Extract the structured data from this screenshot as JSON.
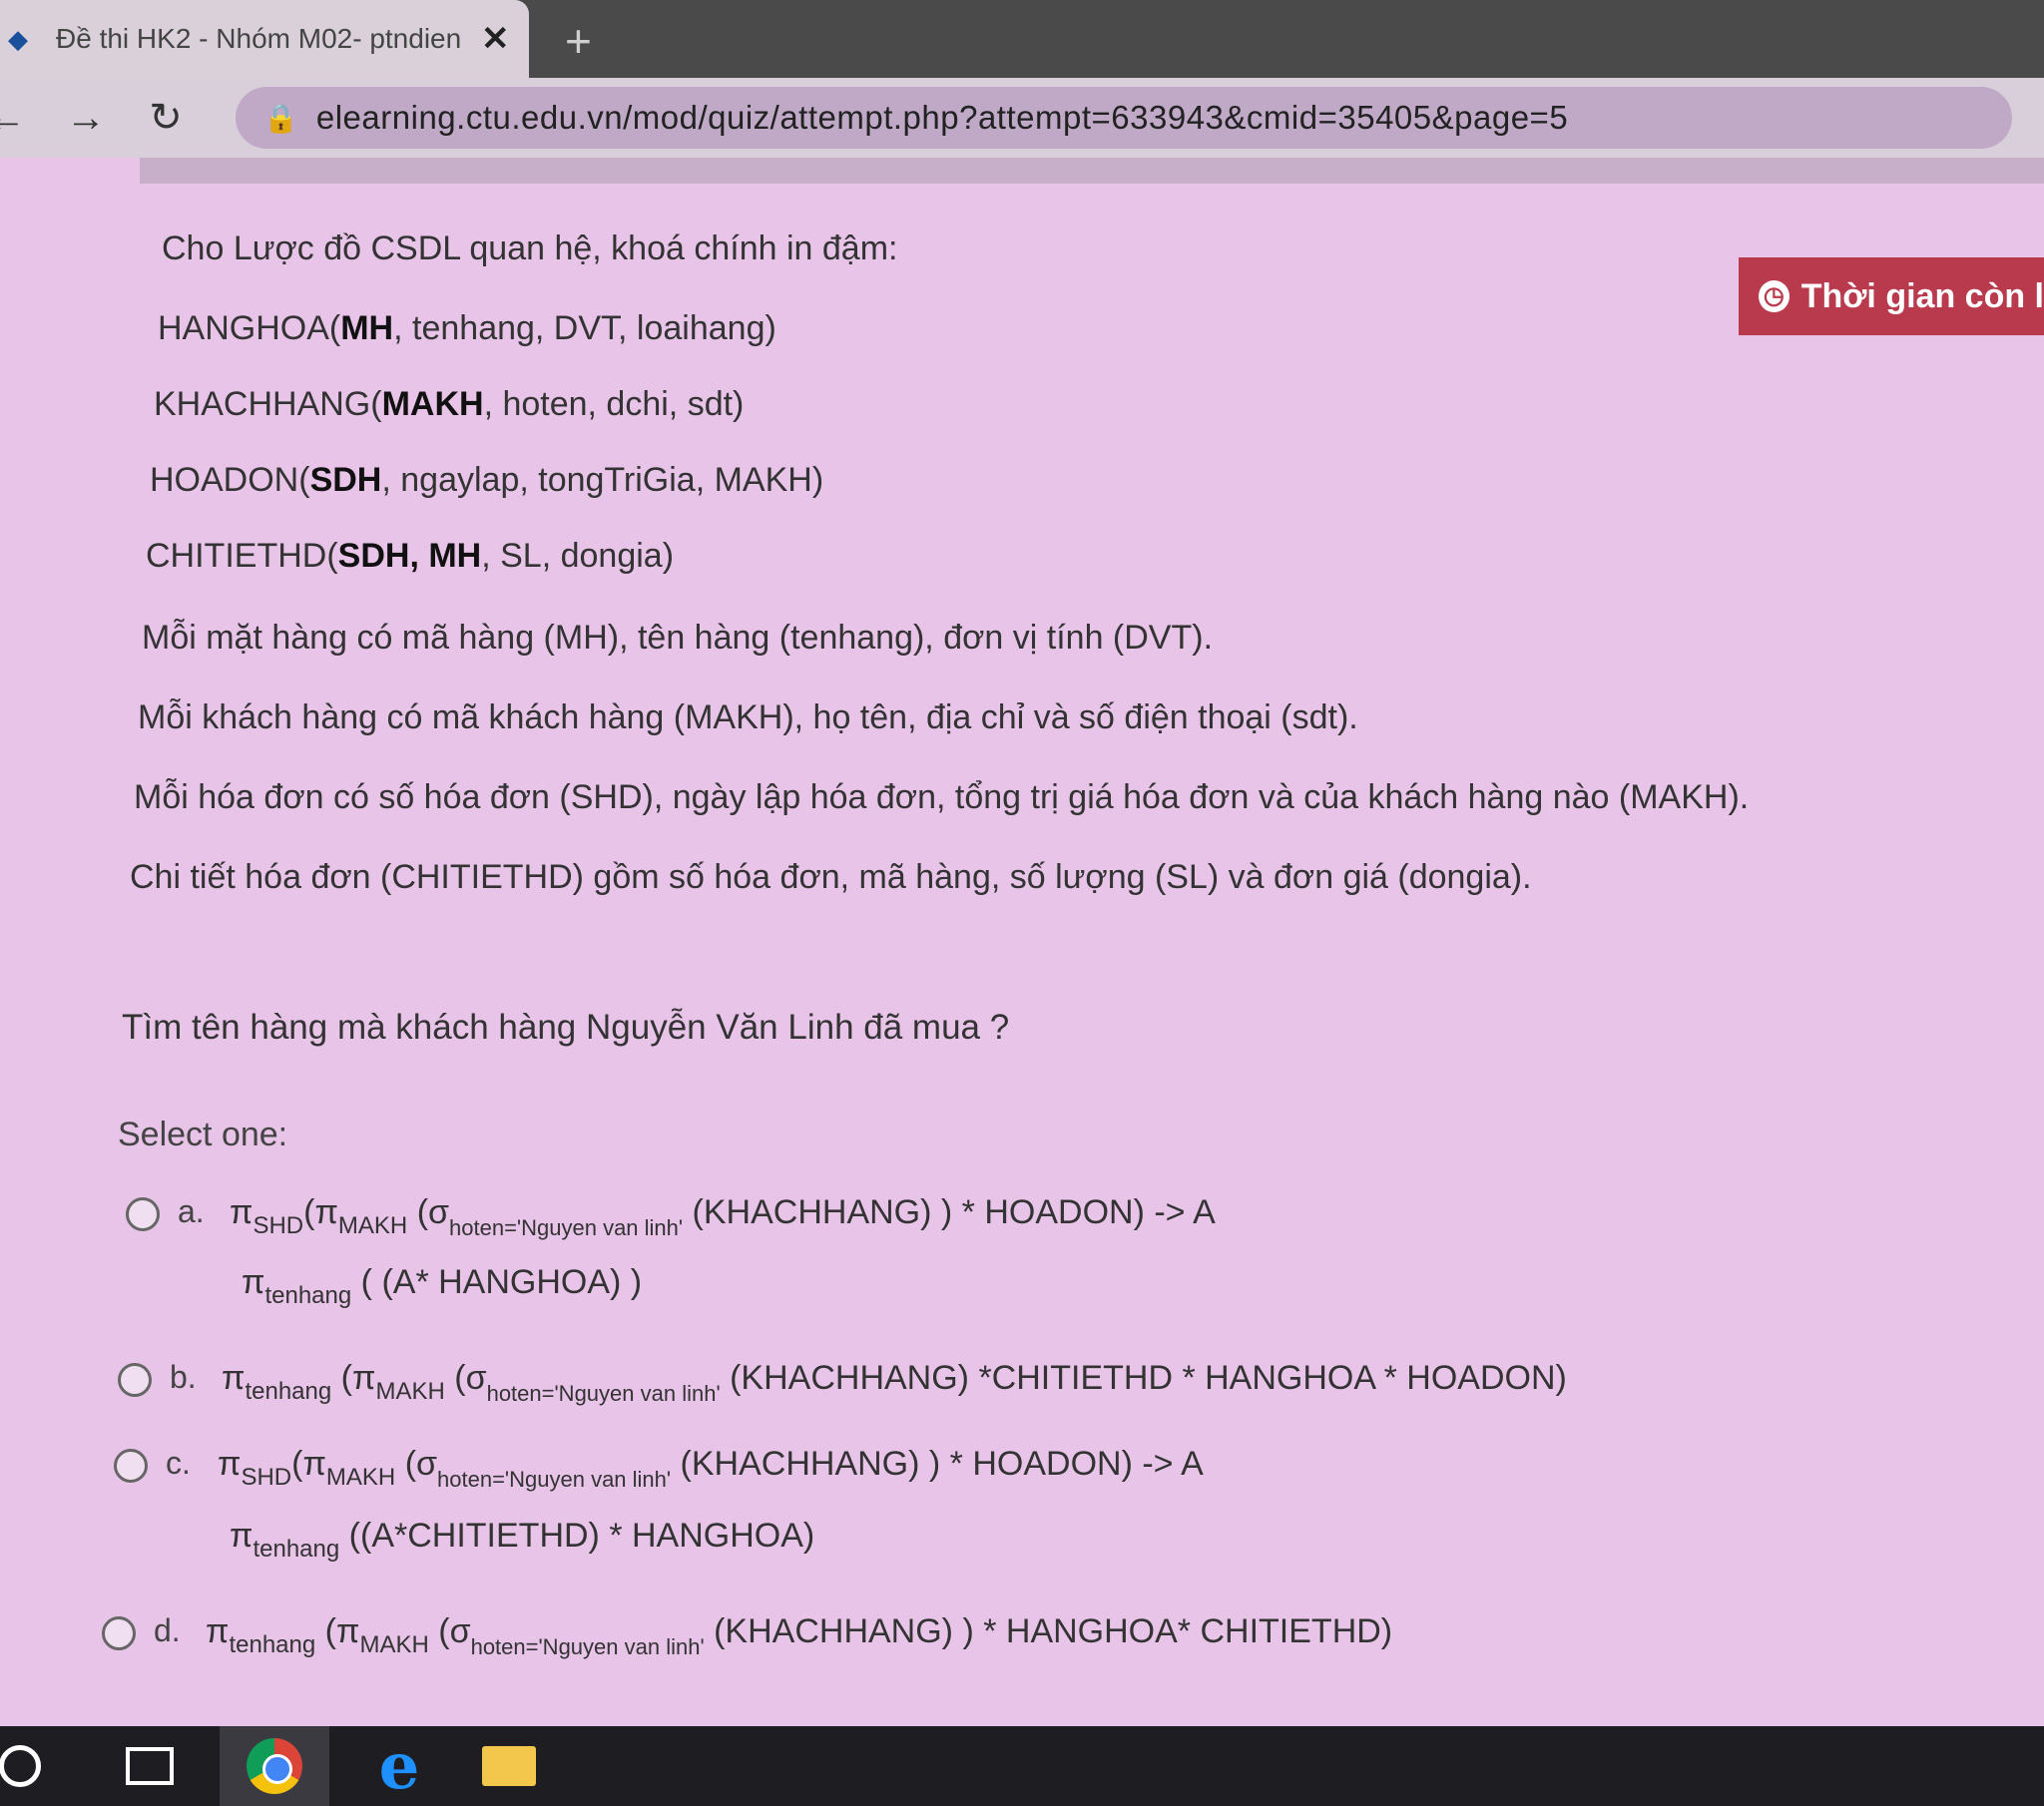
{
  "browser": {
    "tab_title": "Đề thi HK2 - Nhóm M02- ptndien",
    "tab_close": "✕",
    "new_tab": "+",
    "back": "←",
    "forward": "→",
    "reload": "↻",
    "url": "elearning.ctu.edu.vn/mod/quiz/attempt.php?attempt=633943&cmid=35405&page=5"
  },
  "timer": {
    "label": "Thời gian còn l"
  },
  "question": {
    "intro": "Cho Lược đồ CSDL quan hệ, khoá chính in đậm:",
    "schemas": [
      {
        "name": "HANGHOA(",
        "keys": "MH",
        "rest": ", tenhang, DVT, loaihang)"
      },
      {
        "name": "KHACHHANG(",
        "keys": "MAKH",
        "rest": ", hoten, dchi, sdt)"
      },
      {
        "name": "HOADON(",
        "keys": "SDH",
        "rest": ", ngaylap, tongTriGia, MAKH)"
      },
      {
        "name": "CHITIETHD(",
        "keys": "SDH, MH",
        "rest": ", SL, dongia)"
      }
    ],
    "descriptions": [
      "Mỗi mặt hàng có mã hàng (MH), tên hàng (tenhang), đơn vị tính (DVT).",
      "Mỗi khách hàng có mã khách hàng (MAKH), họ tên, địa chỉ và số điện thoại (sdt).",
      "Mỗi hóa đơn có số hóa đơn (SHD), ngày lập hóa đơn, tổng trị giá hóa đơn và của khách hàng nào (MAKH).",
      "Chi tiết hóa đơn (CHITIETHD) gồm số hóa đơn, mã hàng, số lượng (SL) và đơn giá (dongia)."
    ],
    "prompt": "Tìm tên hàng mà khách hàng Nguyễn Văn Linh đã mua ?",
    "select_one": "Select one:",
    "options": [
      {
        "letter": "a.",
        "line1": {
          "p1": "π",
          "s1": "SHD",
          "p2": "(π",
          "s2": "MAKH",
          "p3": " (σ",
          "s3": "hoten='Nguyen van linh'",
          "p4": " (KHACHHANG) ) * HOADON) -> A"
        },
        "line2": {
          "p1": "π",
          "s1": "tenhang",
          "p2": " ( (A* HANGHOA) )"
        }
      },
      {
        "letter": "b.",
        "line1": {
          "p1": "π",
          "s1": "tenhang",
          "p2": " (π",
          "s2": "MAKH",
          "p3": " (σ",
          "s3": "hoten='Nguyen van linh'",
          "p4": " (KHACHHANG) *CHITIETHD * HANGHOA * HOADON)"
        }
      },
      {
        "letter": "c.",
        "line1": {
          "p1": "π",
          "s1": "SHD",
          "p2": "(π",
          "s2": "MAKH",
          "p3": " (σ",
          "s3": "hoten='Nguyen van linh'",
          "p4": " (KHACHHANG) ) * HOADON) -> A"
        },
        "line2": {
          "p1": "π",
          "s1": "tenhang",
          "p2": " ((A*CHITIETHD) * HANGHOA)"
        }
      },
      {
        "letter": "d.",
        "line1": {
          "p1": "π",
          "s1": "tenhang",
          "p2": " (π",
          "s2": "MAKH",
          "p3": " (σ",
          "s3": "hoten='Nguyen van linh'",
          "p4": " (KHACHHANG) ) * HANGHOA* CHITIETHD)"
        }
      }
    ]
  },
  "taskbar": {
    "edge_glyph": "e"
  }
}
